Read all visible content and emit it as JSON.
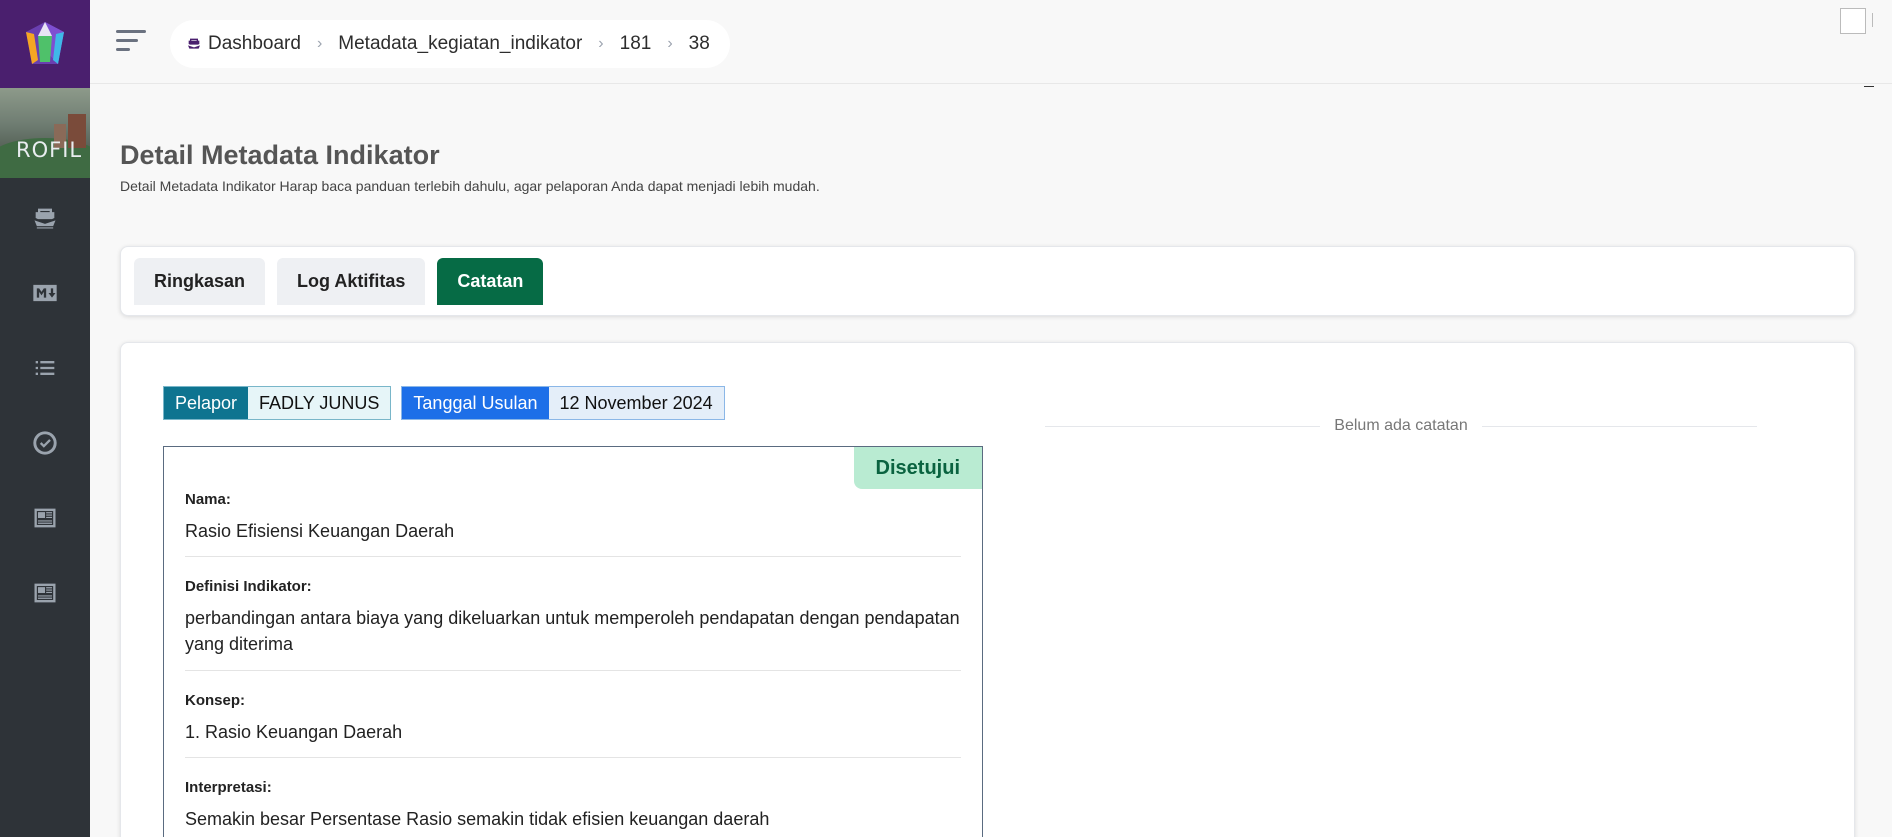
{
  "sidebar": {
    "brand_text": "ROFIL",
    "icons": [
      "ship-icon",
      "markdown-icon",
      "list-icon",
      "check-circle-icon",
      "newspaper-icon",
      "newspaper-icon"
    ]
  },
  "breadcrumb": {
    "items": [
      "Dashboard",
      "Metadata_kegiatan_indikator",
      "181",
      "38"
    ]
  },
  "header": {
    "title": "Detail Metadata Indikator",
    "subtitle": "Detail Metadata Indikator Harap baca panduan terlebih dahulu, agar pelaporan Anda dapat menjadi lebih mudah."
  },
  "tabs": [
    {
      "label": "Ringkasan",
      "active": false
    },
    {
      "label": "Log Aktifitas",
      "active": false
    },
    {
      "label": "Catatan",
      "active": true
    }
  ],
  "chips": {
    "reporter_label": "Pelapor",
    "reporter_value": "FADLY JUNUS",
    "date_label": "Tanggal Usulan",
    "date_value": "12 November 2024"
  },
  "detail": {
    "status": "Disetujui",
    "fields": [
      {
        "label": "Nama:",
        "value": "Rasio Efisiensi Keuangan Daerah"
      },
      {
        "label": "Definisi Indikator:",
        "value": "perbandingan antara biaya yang dikeluarkan untuk memperoleh pendapatan dengan pendapatan yang diterima"
      },
      {
        "label": "Konsep:",
        "value": "1. Rasio Keuangan Daerah"
      },
      {
        "label": "Interpretasi:",
        "value": "Semakin besar Persentase Rasio semakin tidak efisien keuangan daerah"
      }
    ]
  },
  "notes": {
    "empty_text": "Belum ada catatan"
  },
  "colors": {
    "sidebar_bg": "#2e3338",
    "logo_bg": "#4a1f6e",
    "tab_active": "#066b45",
    "chip_teal": "#0e7490",
    "chip_blue": "#1d6fe8",
    "status_bg": "#b9ebd2"
  }
}
